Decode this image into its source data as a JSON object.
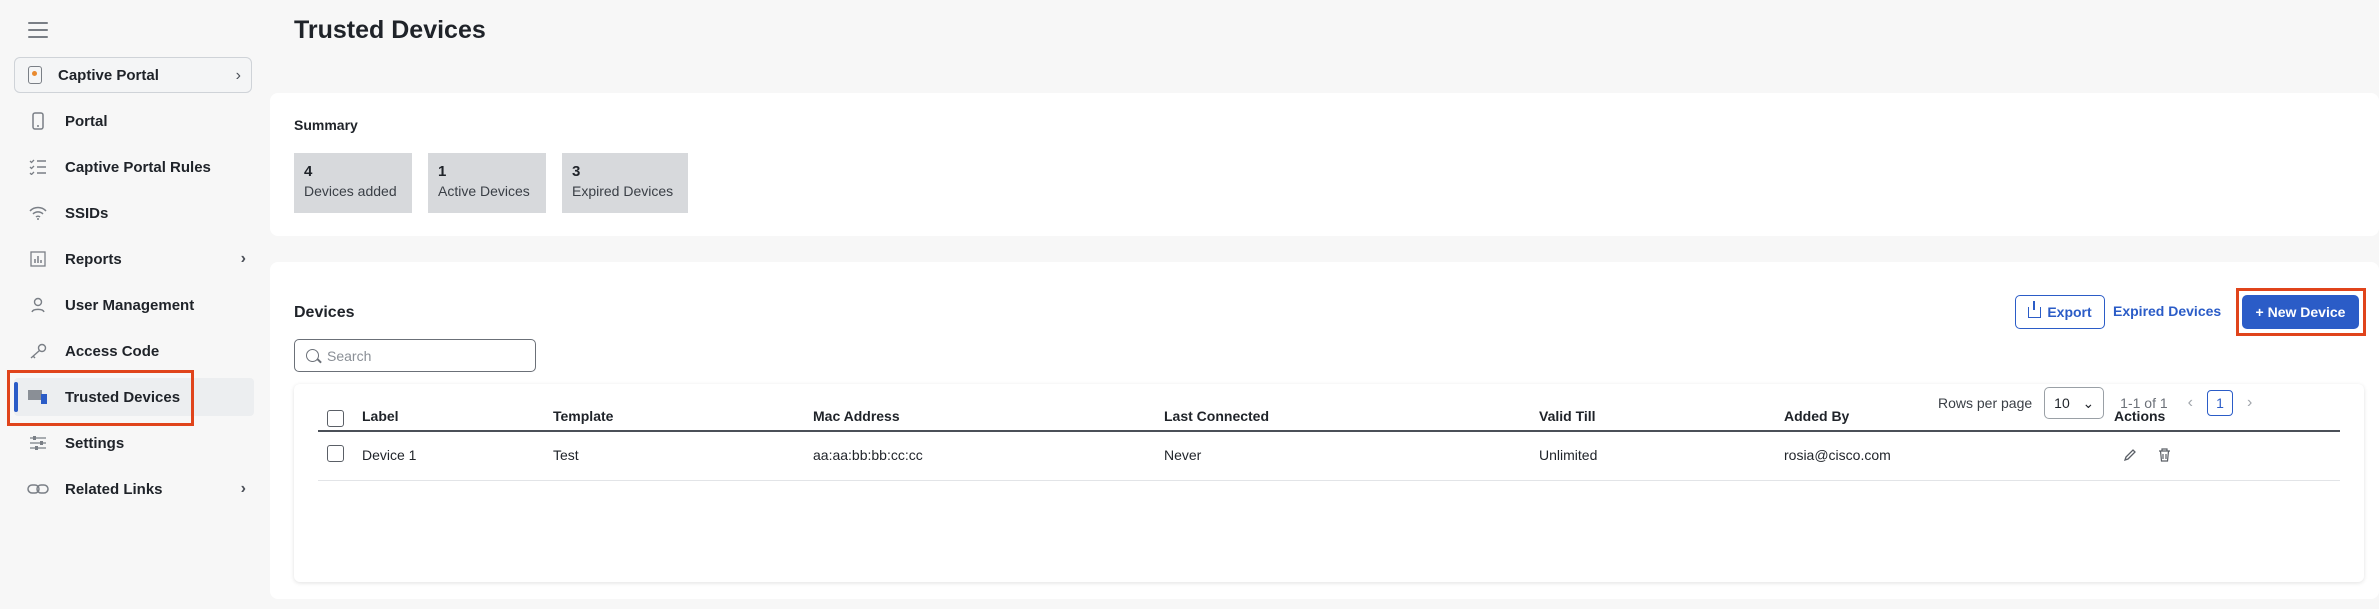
{
  "sidebar": {
    "portal_select": {
      "label": "Captive Portal"
    },
    "items": [
      {
        "label": "Portal",
        "icon": "phone-icon"
      },
      {
        "label": "Captive Portal Rules",
        "icon": "checklist-icon"
      },
      {
        "label": "SSIDs",
        "icon": "wifi-icon"
      },
      {
        "label": "Reports",
        "icon": "bar-chart-icon"
      },
      {
        "label": "User Management",
        "icon": "user-icon"
      },
      {
        "label": "Access Code",
        "icon": "key-icon"
      },
      {
        "label": "Trusted Devices",
        "icon": "devices-icon"
      },
      {
        "label": "Settings",
        "icon": "sliders-icon"
      },
      {
        "label": "Related Links",
        "icon": "link-icon"
      }
    ],
    "active_item": "Trusted Devices"
  },
  "page": {
    "title": "Trusted Devices"
  },
  "summary": {
    "title": "Summary",
    "stats": [
      {
        "value": "4",
        "label": "Devices added"
      },
      {
        "value": "1",
        "label": "Active Devices"
      },
      {
        "value": "3",
        "label": "Expired Devices"
      }
    ]
  },
  "devices": {
    "title": "Devices",
    "search_placeholder": "Search",
    "export_label": "Export",
    "expired_link": "Expired Devices",
    "new_device_label": "+ New Device",
    "columns": [
      "Label",
      "Template",
      "Mac Address",
      "Last Connected",
      "Valid Till",
      "Added By",
      "Actions"
    ],
    "rows": [
      [
        "Device 1",
        "Test",
        "aa:aa:bb:bb:cc:cc",
        "Never",
        "Unlimited",
        "rosia@cisco.com"
      ]
    ],
    "pagination": {
      "rows_per_page_label": "Rows per page",
      "rows_per_page": "10",
      "range": "1-1 of 1",
      "current_page": "1"
    }
  },
  "colors": {
    "accent": "#2b5cc7",
    "highlight": "#e0441b"
  }
}
